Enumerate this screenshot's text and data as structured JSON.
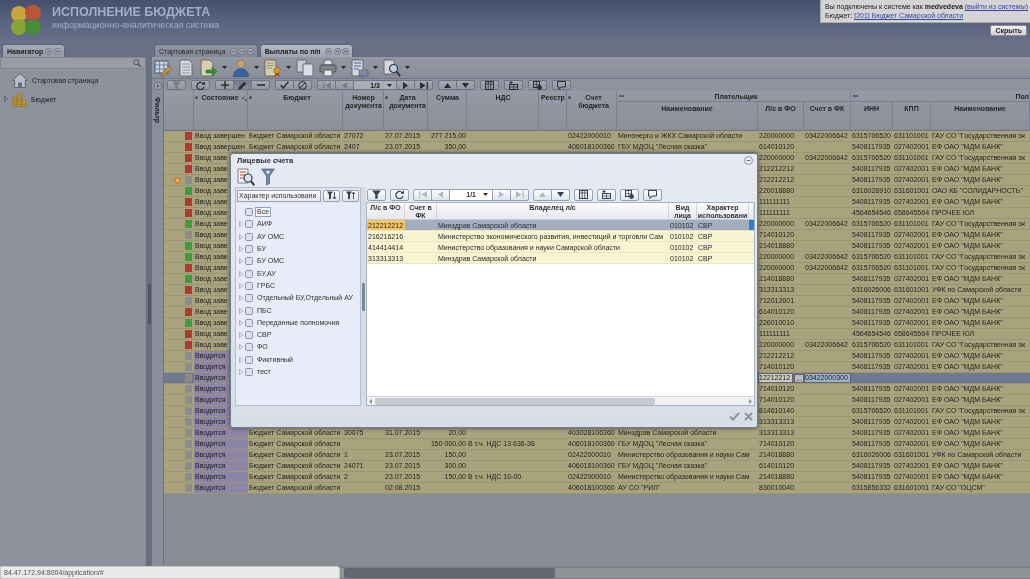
{
  "header": {
    "title": "ИСПОЛНЕНИЕ БЮДЖЕТА",
    "subtitle": "информационно-аналитическая система"
  },
  "session": {
    "text": "Вы подключены к системе как **medvedeva**",
    "logout": "(выйти из системы)",
    "budget_label": "Бюджет:",
    "budget": "[201] Бюджет Самарской области",
    "hide_button": "Скрыть"
  },
  "navigator": {
    "title": "Навигатор",
    "items": [
      {
        "label": "Стартовая страница",
        "expandable": false
      },
      {
        "label": "Бюджет",
        "expandable": true
      }
    ]
  },
  "tabs": [
    {
      "label": "Стартовая страница",
      "selected": false
    },
    {
      "label": "Выплаты по п/п",
      "selected": true
    }
  ],
  "toolbar": [
    {
      "kind": "grid-edit",
      "dropdown": false
    },
    {
      "kind": "document",
      "dropdown": false
    },
    {
      "kind": "export",
      "dropdown": true
    },
    {
      "kind": "person",
      "dropdown": true
    },
    {
      "kind": "certificate",
      "dropdown": true
    },
    {
      "kind": "copy",
      "dropdown": false
    },
    {
      "kind": "print",
      "dropdown": true
    },
    {
      "kind": "report",
      "dropdown": true
    },
    {
      "kind": "search",
      "dropdown": true
    }
  ],
  "filter_panel": {
    "label": "Фильтр"
  },
  "record_toolbar": {
    "groups": [
      [
        {
          "kind": "filter",
          "disabled": true,
          "pressed": false
        }
      ],
      [
        {
          "kind": "refresh",
          "disabled": false,
          "pressed": false
        }
      ],
      [
        {
          "kind": "add",
          "disabled": false,
          "pressed": false
        },
        {
          "kind": "edit",
          "disabled": false,
          "pressed": true
        },
        {
          "kind": "remove",
          "disabled": false,
          "pressed": false
        }
      ],
      [
        {
          "kind": "confirm",
          "disabled": false,
          "pressed": false
        },
        {
          "kind": "cancel",
          "disabled": false,
          "pressed": false
        }
      ],
      [
        {
          "kind": "first",
          "disabled": true,
          "pressed": false
        },
        {
          "kind": "prev",
          "disabled": true,
          "pressed": false
        },
        {
          "kind": "pager",
          "label": "1/3",
          "disabled": false,
          "pressed": false
        },
        {
          "kind": "next",
          "disabled": false,
          "pressed": false
        },
        {
          "kind": "last",
          "disabled": false,
          "pressed": false
        }
      ],
      [
        {
          "kind": "up",
          "disabled": false,
          "pressed": false
        },
        {
          "kind": "down",
          "disabled": false,
          "pressed": false
        }
      ],
      [
        {
          "kind": "columns",
          "disabled": false,
          "pressed": false
        }
      ],
      [
        {
          "kind": "add-row",
          "disabled": false,
          "pressed": false
        }
      ],
      [
        {
          "kind": "settings",
          "disabled": false,
          "pressed": false
        }
      ],
      [
        {
          "kind": "comment",
          "disabled": false,
          "pressed": false
        }
      ]
    ]
  },
  "table": {
    "columns": [
      {
        "label": "Состояние",
        "marker": true,
        "sorted": true
      },
      {
        "label": "Бюджет",
        "marker": true,
        "sorted": false
      },
      {
        "label": "Номер документа",
        "marker": false,
        "sorted": false
      },
      {
        "label": "Дата документа",
        "marker": true,
        "sorted": false
      },
      {
        "label": "Сумма",
        "marker": false,
        "sorted": false
      },
      {
        "label": "НДС",
        "marker": false,
        "sorted": false
      },
      {
        "label": "Реестр",
        "marker": false,
        "sorted": false
      },
      {
        "label": "Счет бюджета",
        "marker": true,
        "sorted": false
      }
    ],
    "groups": [
      {
        "label": "Плательщик",
        "columns": [
          "Наименование",
          "Л/с в ФО",
          "Счет в ФК"
        ]
      },
      {
        "label": "Пол",
        "columns": [
          "ИНН",
          "КПП",
          "Наименование"
        ]
      }
    ],
    "rows": [
      {
        "kind": "done",
        "color": "#b3372e",
        "marked": false,
        "selected": false,
        "editing": false,
        "cells": [
          "Ввод завершен",
          "Бюджет Самарской области",
          "27072",
          "27.07.2015",
          "277 215,00",
          null,
          null,
          "02422000010",
          "Минэнерго и ЖКХ Самарской области",
          "220000000",
          "03422006642",
          "6315706520",
          "631101001",
          "ГАУ СО \"Государственная эк"
        ]
      },
      {
        "kind": "done",
        "color": "#b3372e",
        "marked": false,
        "selected": false,
        "editing": false,
        "cells": [
          "Ввод завершен",
          "Бюджет Самарской области",
          "2407",
          "23.07.2015",
          "350,00",
          null,
          null,
          "406018100360",
          "ГБУ МДОЦ \"Лесная сказка\"",
          "614010120",
          null,
          "5408117935",
          "027402001",
          "ЕФ ОАО \"МДМ БАНК\""
        ]
      },
      {
        "kind": "done",
        "color": "#b3372e",
        "marked": false,
        "selected": false,
        "editing": false,
        "cells": [
          "Ввод заве",
          null,
          null,
          null,
          null,
          null,
          null,
          null,
          null,
          "220000000",
          "03422006642",
          "6315706520",
          "631101001",
          "ГАУ СО \"Государственная эк"
        ]
      },
      {
        "kind": "done",
        "color": "#b3372e",
        "marked": false,
        "selected": false,
        "editing": false,
        "cells": [
          "Ввод заве",
          null,
          null,
          null,
          null,
          null,
          null,
          null,
          null,
          "212212212",
          null,
          "5408117935",
          "027402001",
          "ЕФ ОАО \"МДМ БАНК\""
        ]
      },
      {
        "kind": "done",
        "color": "#8c8c8c",
        "marked": true,
        "selected": false,
        "editing": false,
        "cells": [
          "Ввод заве",
          null,
          null,
          null,
          null,
          null,
          null,
          null,
          null,
          "212212212",
          null,
          "5408117935",
          "027402001",
          "ЕФ ОАО \"МДМ БАНК\""
        ]
      },
      {
        "kind": "done",
        "color": "#3e9c3e",
        "marked": false,
        "selected": false,
        "editing": false,
        "cells": [
          "Ввод заве",
          null,
          null,
          null,
          null,
          null,
          null,
          null,
          null,
          "220018880",
          null,
          "6316028910",
          "631601001",
          "ОАО КБ \"СОЛИДАРНОСТЬ\""
        ]
      },
      {
        "kind": "done",
        "color": "#b3372e",
        "marked": false,
        "selected": false,
        "editing": false,
        "cells": [
          "Ввод заве",
          null,
          null,
          null,
          null,
          null,
          null,
          null,
          null,
          "111111111",
          null,
          "5408117935",
          "027402001",
          "ЕФ ОАО \"МДМ БАНК\""
        ]
      },
      {
        "kind": "done",
        "color": "#b3372e",
        "marked": false,
        "selected": false,
        "editing": false,
        "cells": [
          "Ввод заве",
          null,
          null,
          null,
          null,
          null,
          null,
          null,
          null,
          "111111111",
          null,
          "4564654546",
          "658645564",
          "ПРОЧЕЕ ЮЛ"
        ]
      },
      {
        "kind": "done",
        "color": "#3e9c3e",
        "marked": false,
        "selected": false,
        "editing": false,
        "cells": [
          "Ввод заве",
          null,
          null,
          null,
          null,
          null,
          null,
          null,
          null,
          "220000000",
          "03422006642",
          "6315706520",
          "631101001",
          "ГАУ СО \"Государственная эк"
        ]
      },
      {
        "kind": "done",
        "color": "#8c8c8c",
        "marked": false,
        "selected": false,
        "editing": false,
        "cells": [
          "Ввод заве",
          null,
          null,
          null,
          null,
          null,
          null,
          null,
          null,
          "714010120",
          null,
          "5408117935",
          "027402001",
          "ЕФ ОАО \"МДМ БАНК\""
        ]
      },
      {
        "kind": "done",
        "color": "#3e9c3e",
        "marked": false,
        "selected": false,
        "editing": false,
        "cells": [
          "Ввод заве",
          null,
          null,
          null,
          null,
          null,
          null,
          null,
          null,
          "214018880",
          null,
          "5408117935",
          "027402001",
          "ЕФ ОАО \"МДМ БАНК\""
        ]
      },
      {
        "kind": "done",
        "color": "#3e9c3e",
        "marked": false,
        "selected": false,
        "editing": false,
        "cells": [
          "Ввод заве",
          null,
          null,
          null,
          null,
          null,
          null,
          null,
          null,
          "220000000",
          "03422006642",
          "6315706520",
          "631101001",
          "ГАУ СО \"Государственная эк"
        ]
      },
      {
        "kind": "done",
        "color": "#b3372e",
        "marked": false,
        "selected": false,
        "editing": false,
        "cells": [
          "Ввод заве",
          null,
          null,
          null,
          null,
          null,
          null,
          null,
          null,
          "220000000",
          "03422006642",
          "6315706520",
          "631101001",
          "ГАУ СО \"Государственная эк"
        ]
      },
      {
        "kind": "done",
        "color": "#3e9c3e",
        "marked": false,
        "selected": false,
        "editing": false,
        "cells": [
          "Ввод заве",
          null,
          null,
          null,
          null,
          null,
          null,
          null,
          null,
          "214018880",
          null,
          "5408117935",
          "027402001",
          "ЕФ ОАО \"МДМ БАНК\""
        ]
      },
      {
        "kind": "done",
        "color": "#b3372e",
        "marked": false,
        "selected": false,
        "editing": false,
        "cells": [
          "Ввод заве",
          null,
          null,
          null,
          null,
          null,
          null,
          null,
          null,
          "313313313",
          null,
          "6316026006",
          "631601001",
          "УФК по Самарской области"
        ]
      },
      {
        "kind": "done",
        "color": "#8c8c8c",
        "marked": false,
        "selected": false,
        "editing": false,
        "cells": [
          "Ввод заве",
          null,
          null,
          null,
          null,
          null,
          null,
          null,
          null,
          "712012601",
          null,
          "5408117935",
          "027402001",
          "ЕФ ОАО \"МДМ БАНК\""
        ]
      },
      {
        "kind": "done",
        "color": "#b3372e",
        "marked": false,
        "selected": false,
        "editing": false,
        "cells": [
          "Ввод заве",
          null,
          null,
          null,
          null,
          null,
          null,
          null,
          null,
          "614010120",
          null,
          "5408117935",
          "027402001",
          "ЕФ ОАО \"МДМ БАНК\""
        ]
      },
      {
        "kind": "done",
        "color": "#3e9c3e",
        "marked": false,
        "selected": false,
        "editing": false,
        "cells": [
          "Ввод заве",
          null,
          null,
          null,
          null,
          null,
          null,
          null,
          null,
          "226010010",
          null,
          "5408117935",
          "027402001",
          "ЕФ ОАО \"МДМ БАНК\""
        ]
      },
      {
        "kind": "done",
        "color": "#b3372e",
        "marked": false,
        "selected": false,
        "editing": false,
        "cells": [
          "Ввод заве",
          null,
          null,
          null,
          null,
          null,
          null,
          null,
          null,
          "111111111",
          null,
          "4564654546",
          "658645564",
          "ПРОЧЕЕ ЮЛ"
        ]
      },
      {
        "kind": "done",
        "color": "#b3372e",
        "marked": false,
        "selected": false,
        "editing": false,
        "cells": [
          "Ввод заве",
          null,
          null,
          null,
          null,
          null,
          null,
          null,
          null,
          "220000000",
          "03422006642",
          "6315706520",
          "631101001",
          "ГАУ СО \"Государственная эк"
        ]
      },
      {
        "kind": "entering",
        "color": "#8c8c8c",
        "marked": false,
        "selected": false,
        "editing": false,
        "cells": [
          "Вводится",
          null,
          null,
          null,
          null,
          null,
          null,
          null,
          null,
          "212212212",
          null,
          "5408117935",
          "027402001",
          "ЕФ ОАО \"МДМ БАНК\""
        ]
      },
      {
        "kind": "entering",
        "color": "#8c8c8c",
        "marked": false,
        "selected": false,
        "editing": false,
        "cells": [
          "Вводится",
          null,
          null,
          null,
          null,
          null,
          null,
          null,
          null,
          "714010120",
          null,
          "5408117935",
          "027402001",
          "ЕФ ОАО \"МДМ БАНК\""
        ]
      },
      {
        "kind": "entering",
        "color": "#8c8c8c",
        "marked": false,
        "selected": true,
        "editing": true,
        "picker": "...",
        "cells": [
          "Вводится",
          null,
          null,
          null,
          null,
          null,
          null,
          null,
          null,
          "12212212",
          "03422000300",
          null,
          null,
          null
        ]
      },
      {
        "kind": "entering",
        "color": "#8c8c8c",
        "marked": false,
        "selected": false,
        "editing": false,
        "cells": [
          "Вводится",
          null,
          null,
          null,
          null,
          null,
          null,
          null,
          null,
          "714010120",
          null,
          "5408117935",
          "027402001",
          "ЕФ ОАО \"МДМ БАНК\""
        ]
      },
      {
        "kind": "entering",
        "color": "#8c8c8c",
        "marked": false,
        "selected": false,
        "editing": false,
        "cells": [
          "Вводится",
          null,
          null,
          null,
          null,
          null,
          null,
          null,
          null,
          "714010120",
          null,
          "5408117935",
          "027402001",
          "ЕФ ОАО \"МДМ БАНК\""
        ]
      },
      {
        "kind": "entering",
        "color": "#8c8c8c",
        "marked": false,
        "selected": false,
        "editing": false,
        "cells": [
          "Вводится",
          null,
          null,
          null,
          null,
          null,
          null,
          null,
          null,
          "814610140",
          null,
          "6315706520",
          "631101001",
          "ГАУ СО \"Государственная эк"
        ]
      },
      {
        "kind": "entering",
        "color": "#8c8c8c",
        "marked": false,
        "selected": false,
        "editing": false,
        "cells": [
          "Вводится",
          null,
          null,
          null,
          null,
          null,
          null,
          null,
          null,
          "313313313",
          null,
          "5408117935",
          "027402001",
          "ЕФ ОАО \"МДМ БАНК\""
        ]
      },
      {
        "kind": "entering",
        "color": "#8c8c8c",
        "marked": false,
        "selected": false,
        "editing": false,
        "cells": [
          "Вводится",
          "Бюджет Самарской области",
          "30075",
          "31.07.2015",
          "20,00",
          null,
          null,
          "403028106360",
          "Минздрав Самарской области",
          "313313313",
          null,
          "5408117935",
          "027402001",
          "ЕФ ОАО \"МДМ БАНК\""
        ]
      },
      {
        "kind": "entering",
        "color": "#8c8c8c",
        "marked": false,
        "selected": false,
        "editing": false,
        "cells": [
          "Вводится",
          "Бюджет Самарской области",
          null,
          null,
          "150 000,00",
          "В т.ч. НДС 13 636-36",
          null,
          "406018100360",
          "ГБУ МДОЦ \"Лесная сказка\"",
          "714010120",
          null,
          "5408117935",
          "027402001",
          "ЕФ ОАО \"МДМ БАНК\""
        ]
      },
      {
        "kind": "entering",
        "color": "#8c8c8c",
        "marked": false,
        "selected": false,
        "editing": false,
        "cells": [
          "Вводится",
          "Бюджет Самарской области",
          "1",
          "23.07.2015",
          "150,00",
          null,
          null,
          "02422000010",
          "Министерство образования и науки Сам",
          "214018880",
          null,
          "6316026006",
          "631601001",
          "УФК по Самарской области"
        ]
      },
      {
        "kind": "entering",
        "color": "#8c8c8c",
        "marked": false,
        "selected": false,
        "editing": false,
        "cells": [
          "Вводится",
          "Бюджет Самарской области",
          "24071",
          "23.07.2015",
          "300,00",
          null,
          null,
          "406018100360",
          "ГБУ МДОЦ \"Лесная сказка\"",
          "614010120",
          null,
          "5408117935",
          "027402001",
          "ЕФ ОАО \"МДМ БАНК\""
        ]
      },
      {
        "kind": "entering",
        "color": "#8c8c8c",
        "marked": false,
        "selected": false,
        "editing": false,
        "cells": [
          "Вводится",
          "Бюджет Самарской области",
          "2",
          "23.07.2015",
          "150,00",
          "В т.ч. НДС 10-00",
          null,
          "02422000010",
          "Министерство образования и науки Сам",
          "214018880",
          null,
          "5408117935",
          "027402001",
          "ЕФ ОАО \"МДМ БАНК\""
        ]
      },
      {
        "kind": "entering",
        "color": "#8c8c8c",
        "marked": false,
        "selected": false,
        "editing": false,
        "cells": [
          "Вводится",
          "Бюджет Самарской области",
          null,
          "02.08.2015",
          null,
          null,
          null,
          "406018100360",
          "АУ СО \"РИЛ\"",
          "830010040",
          null,
          "6315856332",
          "631601001",
          "ГАУ СО \"ОЦСМ\""
        ]
      }
    ]
  },
  "dialog": {
    "title": "Лицевые счета",
    "grouping": "Характер использовани",
    "tree": [
      {
        "label": "Все",
        "checked": false,
        "expandable": false,
        "focused": true
      },
      {
        "label": "АИФ",
        "checked": false,
        "expandable": true,
        "focused": false
      },
      {
        "label": "АУ ОМС",
        "checked": false,
        "expandable": true,
        "focused": false
      },
      {
        "label": "БУ",
        "checked": false,
        "expandable": true,
        "focused": false
      },
      {
        "label": "БУ ОМС",
        "checked": false,
        "expandable": true,
        "focused": false
      },
      {
        "label": "БУ,АУ",
        "checked": false,
        "expandable": true,
        "focused": false
      },
      {
        "label": "ГРБС",
        "checked": false,
        "expandable": true,
        "focused": false
      },
      {
        "label": "Отдельный БУ,Отдельный АУ",
        "checked": false,
        "expandable": true,
        "focused": false
      },
      {
        "label": "ПБС",
        "checked": false,
        "expandable": true,
        "focused": false
      },
      {
        "label": "Переданные полномочия",
        "checked": false,
        "expandable": true,
        "focused": false
      },
      {
        "label": "СВР",
        "checked": false,
        "expandable": true,
        "focused": false
      },
      {
        "label": "ФО",
        "checked": false,
        "expandable": true,
        "focused": false
      },
      {
        "label": "Фиктивный",
        "checked": false,
        "expandable": true,
        "focused": false
      },
      {
        "label": "тест",
        "checked": false,
        "expandable": true,
        "focused": false
      }
    ],
    "toolbar": {
      "groups": [
        [
          {
            "kind": "filter",
            "disabled": false,
            "pressed": false
          }
        ],
        [
          {
            "kind": "refresh",
            "disabled": false,
            "pressed": false
          }
        ],
        [
          {
            "kind": "first",
            "disabled": true,
            "pressed": false
          },
          {
            "kind": "prev",
            "disabled": true,
            "pressed": false
          },
          {
            "kind": "pager",
            "label": "1/1",
            "disabled": false,
            "pressed": false
          },
          {
            "kind": "next",
            "disabled": true,
            "pressed": false
          },
          {
            "kind": "last",
            "disabled": true,
            "pressed": false
          }
        ],
        [
          {
            "kind": "up",
            "disabled": true,
            "pressed": false
          },
          {
            "kind": "down",
            "disabled": false,
            "pressed": false
          }
        ],
        [
          {
            "kind": "columns",
            "disabled": false,
            "pressed": false
          }
        ],
        [
          {
            "kind": "add-row",
            "disabled": false,
            "pressed": false
          }
        ],
        [
          {
            "kind": "settings",
            "disabled": false,
            "pressed": false
          }
        ],
        [
          {
            "kind": "comment",
            "disabled": false,
            "pressed": false
          }
        ]
      ]
    },
    "columns": [
      "Л/с в ФО",
      "Счет в ФК",
      "Владелец л/с",
      "Вид лица",
      "Характер использовани"
    ],
    "rows": [
      {
        "selected": true,
        "cells": [
          "212212212",
          null,
          "Минздрав Самарской области",
          "010102",
          "СВР"
        ]
      },
      {
        "selected": false,
        "cells": [
          "216216216",
          null,
          "Министерство экономического развития, инвестиций и торговли Сам",
          "010102",
          "СВР"
        ]
      },
      {
        "selected": false,
        "cells": [
          "414414414",
          null,
          "Министерство образования и науки Самарской области",
          "010102",
          "СВР"
        ]
      },
      {
        "selected": false,
        "cells": [
          "313313313",
          null,
          "Минздрав Самарской области",
          "010102",
          "СВР"
        ]
      }
    ]
  },
  "status_bar": {
    "url": "84.47.172.94:8004/application/#"
  }
}
